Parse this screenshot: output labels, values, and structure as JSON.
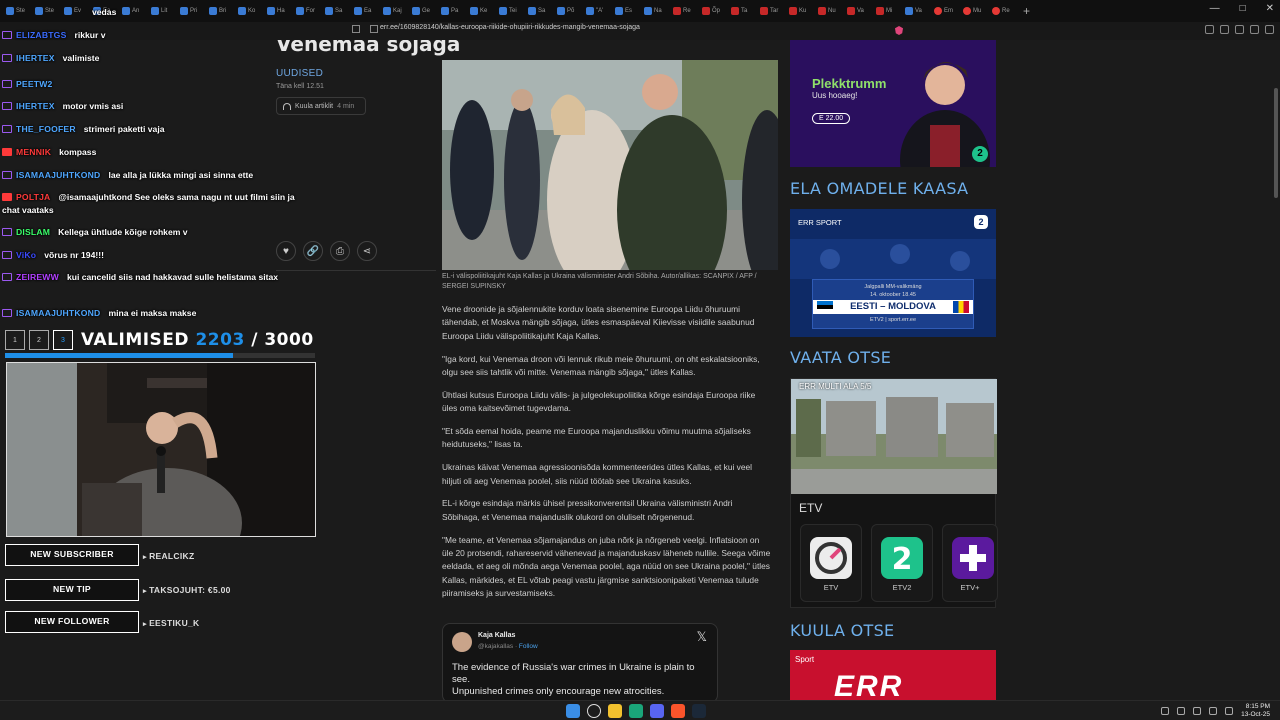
{
  "browser": {
    "url": "err.ee/1609828140/kallas-euroopa-riikide-ohupiiri-rikkudes-mangib-venemaa-sojaga",
    "tabs": [
      "Ste",
      "Ste",
      "Ev",
      "Ea",
      "An",
      "Lit",
      "Pri",
      "Bri",
      "Ko",
      "Ha",
      "For",
      "Sa",
      "Ea",
      "Kaj",
      "Ge",
      "Pa",
      "Ke",
      "Tei",
      "Sa",
      "Põ",
      "\"A'",
      "Es",
      "Na",
      "Re",
      "Õp",
      "Ta",
      "Tar",
      "Ku",
      "Nu",
      "Va",
      "Mi",
      "Va",
      "Em",
      "Mu",
      "Re"
    ]
  },
  "article": {
    "headline": "Venemaa sõjaga",
    "section": "UUDISED",
    "date": "Täna kell 12.51",
    "listen_label": "Kuula artiklit",
    "listen_minutes": "4 min",
    "caption": "EL-i välispoliitikajuht Kaja Kallas ja Ukraina välisminister Andri Sõbiha. Autor/allikas: SCANPIX / AFP / SERGEI SUPINSKY",
    "paragraphs": [
      "Vene droonide ja sõjalennukite korduv loata sisenemine Euroopa Liidu õhuruumi tähendab, et Moskva mängib sõjaga, ütles esmaspäeval Kiievisse visiidile saabunud Euroopa Liidu välispoliitikajuht Kaja Kallas.",
      "\"Iga kord, kui Venemaa droon või lennuk rikub meie õhuruumi, on oht eskalatsiooniks, olgu see siis tahtlik või mitte. Venemaa mängib sõjaga,\" ütles Kallas.",
      "Ühtlasi kutsus Euroopa Liidu välis- ja julgeolekupoliitika kõrge esindaja Euroopa riike üles oma kaitsevõimet tugevdama.",
      "\"Et sõda eemal hoida, peame me Euroopa majanduslikku võimu muutma sõjaliseks heidutuseks,\" lisas ta.",
      "Ukrainas käivat Venemaa agressioonisõda kommenteerides ütles Kallas, et kui veel hiljuti oli aeg Venemaa poolel, siis nüüd töötab see Ukraina kasuks.",
      "EL-i kõrge esindaja märkis ühisel pressikonverentsil Ukraina välisministri Andri Sõbihaga, et Venemaa majanduslik olukord on oluliselt nõrgenenud.",
      "\"Me teame, et Venemaa sõjamajandus on juba nõrk ja nõrgeneb veelgi. Inflatsioon on üle 20 protsendi, rahareservid vähenevad ja majanduskasv läheneb nullile. Seega võime eeldada, et aeg oli mõnda aega Venemaa poolel, aga nüüd on see Ukraina poolel,\" ütles Kallas, märkides, et EL võtab peagi vastu järgmise sanktsioonipaketi Venemaa tulude piiramiseks ja survestamiseks."
    ],
    "tweet": {
      "name": "Kaja Kallas",
      "handle": "@kajakallas",
      "follow": "Follow",
      "text": "The evidence of Russia's war crimes in Ukraine is plain to see.\nUnpunished crimes only encourage new atrocities."
    }
  },
  "sidebar": {
    "ad1_title": "Plekktrumm",
    "ad1_sub": "Uus hooaeg!",
    "ad1_price": "E 22.00",
    "ad1_logo": "2",
    "head1": "ELA OMADELE KAASA",
    "ad2_brand": "ERR SPORT",
    "ad2_logo": "2",
    "ad2_line1": "Jalgpalli MM-valikmäng",
    "ad2_line2": "14. oktoober 18.45",
    "ad2_match": "EESTI – MOLDOVA",
    "ad2_line4": "ETV2 | sport.err.ee",
    "head2": "VAATA OTSE",
    "live_title": "ERR MULTI ALA 5/5",
    "etv_label": "ETV",
    "channels": [
      "ETV",
      "ETV2",
      "ETV+"
    ],
    "head3": "KUULA OTSE",
    "ad3_label": "Sport",
    "ad3_logo": "ERR"
  },
  "overlay": {
    "chat": [
      {
        "user": "",
        "text": "vedas",
        "color": "#ffffff"
      },
      {
        "user": "ELIZABTGS",
        "text": "rikkur v",
        "color": "#3b6cff"
      },
      {
        "user": "IHERTEX",
        "text": "valimiste",
        "color": "#4fa7ff"
      },
      {
        "user": "PEETW2",
        "text": "",
        "color": "#4fa7ff"
      },
      {
        "user": "IHERTEX",
        "text": "motor vmis asi",
        "color": "#4fa7ff"
      },
      {
        "user": "THE_FOOFER",
        "text": "strimeri paketti vaja",
        "color": "#4fa7ff"
      },
      {
        "user": "MENNIK",
        "text": "kompass",
        "color": "#ff3a3a"
      },
      {
        "user": "ISAMAAJUHTKOND",
        "text": "lae alla ja lükka mingi asi sinna ette",
        "color": "#4fa7ff"
      },
      {
        "user": "POLTJA",
        "text": "@isamaajuhtkond See oleks sama nagu nt uut filmi siin ja chat vaataks",
        "color": "#ff3a3a"
      },
      {
        "user": "DISLAM",
        "text": "Kellega ühtlude kõige rohkem v",
        "color": "#3aff6a"
      },
      {
        "user": "ViKo",
        "text": "võrus nr 194!!!",
        "color": "#3b4bff"
      },
      {
        "user": "ZEIREWW",
        "text": "kui cancelid siis nad hakkavad sulle helistama sitax",
        "color": "#b040ff"
      },
      {
        "user": "ISAMAAJUHTKOND",
        "text": "mina ei maksa makse",
        "color": "#4fa7ff"
      }
    ],
    "goal_steps": [
      "1",
      "2",
      "3"
    ],
    "goal_label": "VALIMISED",
    "goal_current": "2203",
    "goal_sep": " / ",
    "goal_target": "3000",
    "goal_progress": 0.7343,
    "alerts": [
      {
        "label": "NEW SUBSCRIBER",
        "value": "REALCIKZ"
      },
      {
        "label": "NEW TIP",
        "value": "TAKSOJUHT: €5.00"
      },
      {
        "label": "NEW FOLLOWER",
        "value": "EESTIKU_K"
      }
    ]
  },
  "taskbar": {
    "time": "8:15 PM",
    "date": "13-Oct-25"
  },
  "colors": {
    "accent": "#6fb0ec",
    "goal_blue": "#1e8fe8",
    "err_red": "#c8102e",
    "etv2_green": "#1ec28b",
    "etvplus_purple": "#5b1a9e"
  }
}
